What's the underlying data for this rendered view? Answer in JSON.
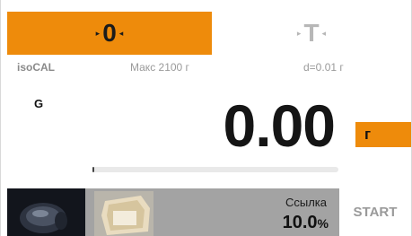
{
  "keys": {
    "zero": {
      "symbol": "0",
      "left_marker": "▸",
      "right_marker": "◂"
    },
    "tare": {
      "symbol": "T",
      "left_marker": "▸",
      "right_marker": "◂"
    }
  },
  "info": {
    "mode": "isoCAL",
    "max": "Макс 2100 г",
    "division": "d=0.01 г"
  },
  "display": {
    "gross_indicator": "G",
    "weight": "0.00",
    "unit": "г"
  },
  "bargraph": {
    "fill_fraction": 0.0
  },
  "reference": {
    "label": "Ссылка",
    "value": "10.0",
    "unit": "%"
  },
  "actions": {
    "start": "START"
  },
  "colors": {
    "accent": "#ee8b0b",
    "muted": "#9a9a9a"
  },
  "icons": {
    "sample_thumbnail": "sample-image-icon",
    "container_thumbnail": "container-image-icon"
  }
}
